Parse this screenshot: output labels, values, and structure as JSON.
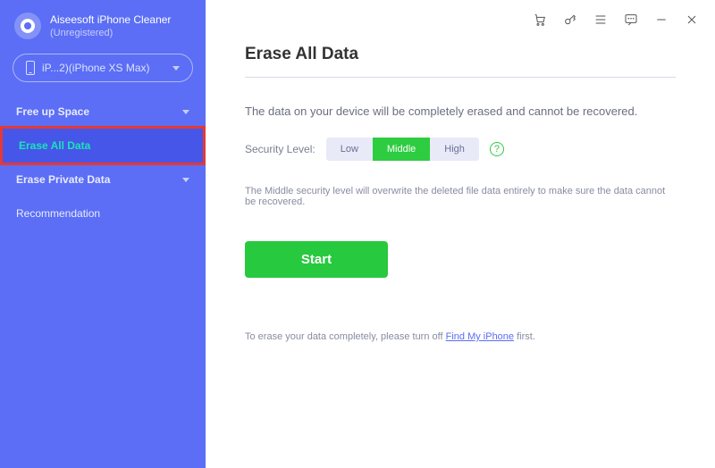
{
  "app": {
    "name": "Aiseesoft iPhone Cleaner",
    "status": "(Unregistered)"
  },
  "device": {
    "label": "iP...2)(iPhone XS Max)"
  },
  "sidebar": {
    "items": [
      {
        "label": "Free up Space",
        "expandable": true,
        "active": false
      },
      {
        "label": "Erase All Data",
        "expandable": false,
        "active": true
      },
      {
        "label": "Erase Private Data",
        "expandable": true,
        "active": false
      },
      {
        "label": "Recommendation",
        "expandable": false,
        "active": false
      }
    ]
  },
  "page": {
    "title": "Erase All Data",
    "lead": "The data on your device will be completely erased and cannot be recovered.",
    "security_label": "Security Level:",
    "levels": {
      "low": "Low",
      "middle": "Middle",
      "high": "High"
    },
    "selected_level": "middle",
    "level_desc": "The Middle security level will overwrite the deleted file data entirely to make sure the data cannot be recovered.",
    "start": "Start",
    "footnote_pre": "To erase your data completely, please turn off ",
    "footnote_link": "Find My iPhone",
    "footnote_post": " first."
  }
}
